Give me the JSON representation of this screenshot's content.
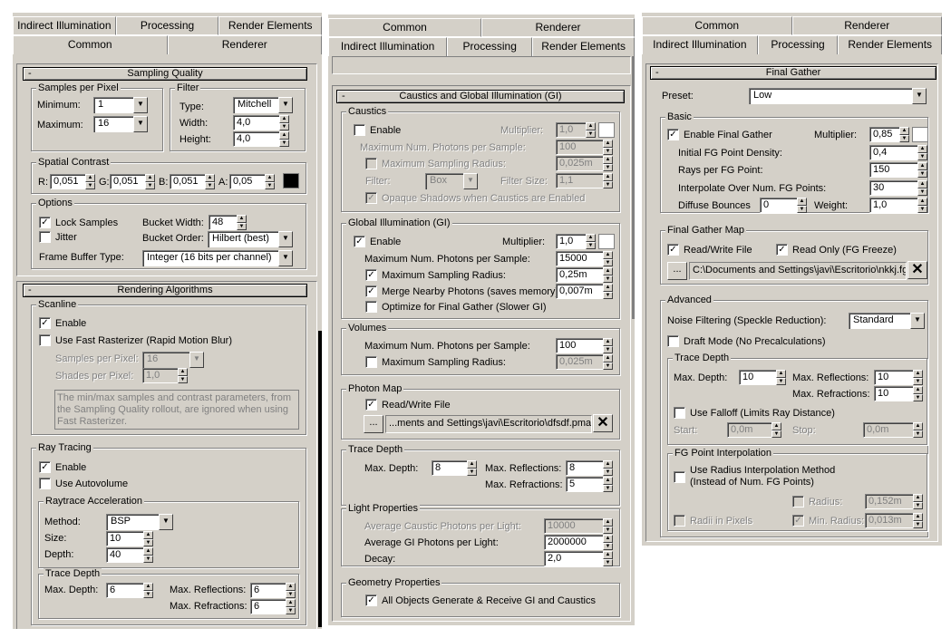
{
  "p1": {
    "tabs_back": [
      "Indirect Illumination",
      "Processing",
      "Render Elements"
    ],
    "tabs_front": [
      "Common",
      "Renderer"
    ],
    "sampling_quality": {
      "title": "Sampling Quality",
      "samples_group": "Samples per Pixel",
      "minimum_label": "Minimum:",
      "minimum": "1",
      "maximum_label": "Maximum:",
      "maximum": "16",
      "filter_group": "Filter",
      "type_label": "Type:",
      "type": "Mitchell",
      "width_label": "Width:",
      "width": "4,0",
      "height_label": "Height:",
      "height": "4,0",
      "spatial_group": "Spatial Contrast",
      "r_label": "R:",
      "r": "0,051",
      "g_label": "G:",
      "g": "0,051",
      "b_label": "B:",
      "b": "0,051",
      "a_label": "A:",
      "a": "0,05",
      "options_group": "Options",
      "lock_samples": "Lock Samples",
      "jitter": "Jitter",
      "bucket_width_label": "Bucket Width:",
      "bucket_width": "48",
      "bucket_order_label": "Bucket Order:",
      "bucket_order": "Hilbert (best)",
      "frame_buffer_label": "Frame Buffer Type:",
      "frame_buffer": "Integer (16 bits per channel)"
    },
    "rendering_algorithms": {
      "title": "Rendering Algorithms",
      "scanline_group": "Scanline",
      "enable": "Enable",
      "fast_rasterizer": "Use Fast Rasterizer (Rapid Motion Blur)",
      "samples_per_pixel_label": "Samples per Pixel:",
      "samples_per_pixel": "16",
      "shades_per_pixel_label": "Shades per Pixel:",
      "shades_per_pixel": "1,0",
      "note": "The min/max samples and contrast parameters, from the Sampling Quality rollout, are ignored when using Fast Rasterizer.",
      "raytracing_group": "Ray Tracing",
      "rt_enable": "Enable",
      "autovolume": "Use Autovolume",
      "accel_group": "Raytrace Acceleration",
      "method_label": "Method:",
      "method": "BSP",
      "size_label": "Size:",
      "size": "10",
      "depth_label": "Depth:",
      "depth": "40",
      "trace_group": "Trace Depth",
      "max_depth_label": "Max. Depth:",
      "max_depth": "6",
      "max_refl_label": "Max. Reflections:",
      "max_refl": "6",
      "max_refr_label": "Max. Refractions:",
      "max_refr": "6"
    }
  },
  "p2": {
    "tabs_back": [
      "Common",
      "Renderer"
    ],
    "tabs_front": [
      "Indirect Illumination",
      "Processing",
      "Render Elements"
    ],
    "caustics_gi": {
      "title": "Caustics and Global Illumination (GI)",
      "caustics_group": "Caustics",
      "c_enable": "Enable",
      "c_multiplier_label": "Multiplier:",
      "c_multiplier": "1,0",
      "c_max_photons_label": "Maximum Num. Photons per Sample:",
      "c_max_photons": "100",
      "c_max_radius": "Maximum Sampling Radius:",
      "c_max_radius_val": "0,025m",
      "c_filter_label": "Filter:",
      "c_filter": "Box",
      "c_filter_size_label": "Filter Size:",
      "c_filter_size": "1,1",
      "c_opaque": "Opaque Shadows when Caustics are Enabled",
      "gi_group": "Global Illumination (GI)",
      "gi_enable": "Enable",
      "gi_multiplier_label": "Multiplier:",
      "gi_multiplier": "1,0",
      "gi_max_photons_label": "Maximum Num. Photons per Sample:",
      "gi_max_photons": "15000",
      "gi_max_radius": "Maximum Sampling Radius:",
      "gi_max_radius_val": "0,25m",
      "gi_merge": "Merge Nearby Photons (saves memory):",
      "gi_merge_val": "0,007m",
      "gi_optimize": "Optimize for Final Gather (Slower GI)",
      "vol_group": "Volumes",
      "vol_max_photons_label": "Maximum Num. Photons per Sample:",
      "vol_max_photons": "100",
      "vol_max_radius": "Maximum Sampling Radius:",
      "vol_max_radius_val": "0,025m",
      "pm_group": "Photon Map",
      "pm_rw": "Read/Write File",
      "pm_browse": "...",
      "pm_path": "...ments and Settings\\javi\\Escritorio\\dfsdf.pmap",
      "td_group": "Trace Depth",
      "td_max_depth_label": "Max. Depth:",
      "td_max_depth": "8",
      "td_refl_label": "Max. Reflections:",
      "td_refl": "8",
      "td_refr_label": "Max. Refractions:",
      "td_refr": "5",
      "lp_group": "Light Properties",
      "lp_avg_caustic_label": "Average Caustic Photons per Light:",
      "lp_avg_caustic": "10000",
      "lp_avg_gi_label": "Average GI Photons per Light:",
      "lp_avg_gi": "2000000",
      "lp_decay_label": "Decay:",
      "lp_decay": "2,0",
      "gp_group": "Geometry Properties",
      "gp_all": "All Objects Generate & Receive GI and Caustics"
    }
  },
  "p3": {
    "tabs_back": [
      "Common",
      "Renderer"
    ],
    "tabs_front": [
      "Indirect Illumination",
      "Processing",
      "Render Elements"
    ],
    "final_gather": {
      "title": "Final Gather",
      "preset_label": "Preset:",
      "preset": "Low",
      "basic_group": "Basic",
      "enable_fg": "Enable Final Gather",
      "multiplier_label": "Multiplier:",
      "multiplier": "0,85",
      "density_label": "Initial FG Point Density:",
      "density": "0,4",
      "rays_label": "Rays per FG Point:",
      "rays": "150",
      "interp_label": "Interpolate Over Num. FG Points:",
      "interp": "30",
      "bounces_label": "Diffuse Bounces",
      "bounces": "0",
      "weight_label": "Weight:",
      "weight": "1,0",
      "map_group": "Final Gather Map",
      "map_rw": "Read/Write File",
      "map_ro": "Read Only (FG Freeze)",
      "map_browse": "...",
      "map_path": "C:\\Documents and Settings\\javi\\Escritorio\\nkkj.fg",
      "adv_group": "Advanced",
      "noise_label": "Noise Filtering (Speckle Reduction):",
      "noise": "Standard",
      "draft": "Draft Mode (No Precalculations)",
      "trace_group": "Trace Depth",
      "max_depth_label": "Max. Depth:",
      "max_depth": "10",
      "max_refl_label": "Max. Reflections:",
      "max_refl": "10",
      "max_refr_label": "Max. Refractions:",
      "max_refr": "10",
      "falloff": "Use Falloff (Limits Ray Distance)",
      "start_label": "Start:",
      "start": "0,0m",
      "stop_label": "Stop:",
      "stop": "0,0m",
      "interp_group": "FG Point Interpolation",
      "radius_method": "Use Radius Interpolation Method",
      "radius_method2": "(Instead of Num. FG Points)",
      "radius_label": "Radius:",
      "radius": "0,152m",
      "radii_pixels": "Radii in Pixels",
      "min_radius_label": "Min. Radius:",
      "min_radius": "0,013m"
    }
  },
  "colors": {
    "panel_bg": "#d4d0c8",
    "swatch_black": "#000000",
    "swatch_white": "#ffffff"
  }
}
